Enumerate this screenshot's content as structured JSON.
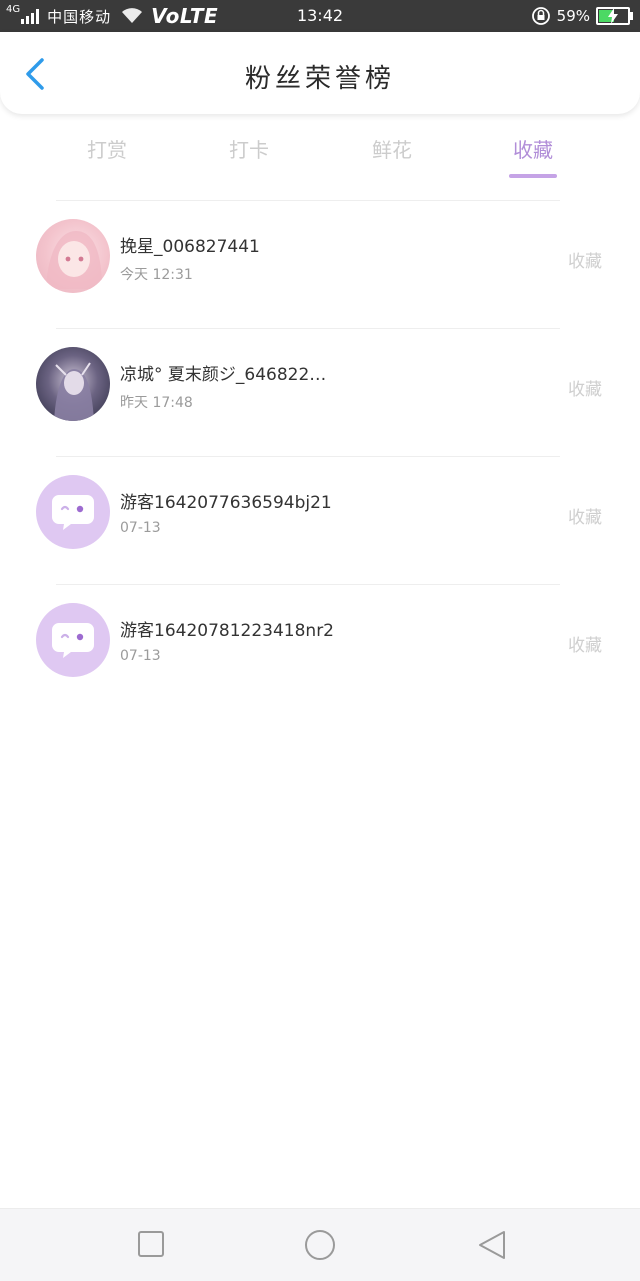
{
  "status_bar": {
    "network": "4G",
    "carrier": "中国移动",
    "volte": "VoLTE",
    "time": "13:42",
    "battery_percent": "59%",
    "battery_level": 0.59,
    "icons": [
      "signal-icon",
      "wifi-icon",
      "rotation-lock-icon",
      "battery-icon"
    ]
  },
  "header": {
    "title": "粉丝荣誉榜",
    "back_icon": "chevron-left-icon",
    "back_color": "#2f9bea"
  },
  "tabs": [
    {
      "label": "打赏",
      "active": false
    },
    {
      "label": "打卡",
      "active": false
    },
    {
      "label": "鲜花",
      "active": false
    },
    {
      "label": "收藏",
      "active": true
    }
  ],
  "accent_color": "#b18ed8",
  "list": [
    {
      "name": "挽星_006827441",
      "date": "今天 12:31",
      "action": "收藏",
      "avatar": "pink-anime-avatar"
    },
    {
      "name": "凉城° 夏末颜ジ_646822…",
      "date": "昨天 17:48",
      "action": "收藏",
      "avatar": "dark-anime-avatar"
    },
    {
      "name": "游客1642077636594bj21",
      "date": "07-13",
      "action": "收藏",
      "avatar": "guest-chat-bubble-icon"
    },
    {
      "name": "游客16420781223418nr2",
      "date": "07-13",
      "action": "收藏",
      "avatar": "guest-chat-bubble-icon"
    }
  ],
  "nav_bar": {
    "icons": [
      "recent-apps-square-icon",
      "home-circle-icon",
      "back-triangle-icon"
    ]
  }
}
